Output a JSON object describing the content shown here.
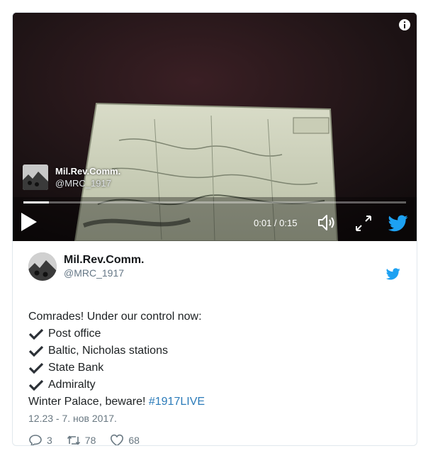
{
  "colors": {
    "twitter_blue": "#1da1f2",
    "link": "#2b7bb9",
    "secondary_text": "#697882",
    "card_border": "#e1e8ed"
  },
  "video": {
    "author_name": "Mil.Rev.Comm.",
    "author_handle": "@MRC_1917",
    "time_readout": "0:01 / 0:15",
    "progress_fraction": 0.066,
    "icons": [
      "info-icon",
      "play-icon",
      "volume-icon",
      "expand-icon",
      "twitter-bird-icon"
    ]
  },
  "tweet": {
    "author_name": "Mil.Rev.Comm.",
    "author_handle": "@MRC_1917",
    "intro": "Comrades! Under our control now:",
    "checklist": [
      "Post office",
      "Baltic, Nicholas stations",
      "State Bank",
      "Admiralty"
    ],
    "closing_text": "Winter Palace, beware! ",
    "hashtag": "#1917LIVE",
    "date": "12.23 - 7. нов 2017.",
    "actions": {
      "replies": "3",
      "retweets": "78",
      "likes": "68"
    }
  }
}
